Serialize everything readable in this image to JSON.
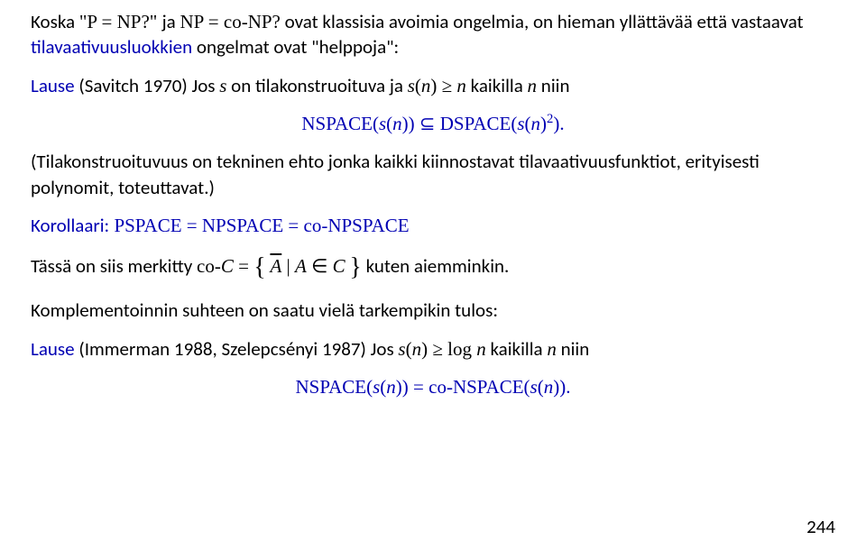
{
  "para1_a": "Koska ",
  "para1_b": "\"P = NP?\" ",
  "para1_c": "ja ",
  "para1_d": "NP = co-NP?",
  "para1_e": " ovat klassisia avoimia ongelmia, on hieman yllättävää että vastaavat ",
  "para1_f": "tilavaativuusluokkien",
  "para1_g": " ongelmat ovat \"helppoja\":",
  "lause1_a": "Lause",
  "lause1_b": " (Savitch 1970) Jos ",
  "lause1_c": "s",
  "lause1_d": " on tilakonstruoituva ja ",
  "lause1_e": "s",
  "lause1_f": "(",
  "lause1_g": "n",
  "lause1_h": ") ≥ ",
  "lause1_i": "n",
  "lause1_j": " kaikilla ",
  "lause1_k": "n",
  "lause1_l": " niin",
  "eq1_a": "NSPACE(",
  "eq1_b": "s",
  "eq1_c": "(",
  "eq1_d": "n",
  "eq1_e": ")) ⊆ DSPACE(",
  "eq1_f": "s",
  "eq1_g": "(",
  "eq1_h": "n",
  "eq1_i": ")",
  "eq1_sup": "2",
  "eq1_j": ").",
  "para2": "(Tilakonstruoituvuus on tekninen ehto jonka kaikki kiinnostavat tilavaativuusfunktiot, erityisesti polynomit, toteuttavat.)",
  "kor_a": "Korollaari:",
  "kor_b": " PSPACE = NPSPACE = co-NPSPACE",
  "para3_a": "Tässä on siis merkitty ",
  "para3_b": "co-",
  "para3_c": "C",
  "para3_d": " = ",
  "para3_e": "A",
  "para3_f": " | ",
  "para3_g": "A",
  "para3_h": " ∈ ",
  "para3_i": "C",
  "para3_j": " kuten aiemminkin.",
  "para4": "Komplementoinnin suhteen on saatu vielä tarkempikin tulos:",
  "lause2_a": "Lause",
  "lause2_b": " (Immerman 1988, Szelepcsényi 1987) Jos ",
  "lause2_c": "s",
  "lause2_d": "(",
  "lause2_e": "n",
  "lause2_f": ") ≥ log ",
  "lause2_g": "n",
  "lause2_h": " kaikilla ",
  "lause2_i": "n",
  "lause2_j": " niin",
  "eq2_a": "NSPACE(",
  "eq2_b": "s",
  "eq2_c": "(",
  "eq2_d": "n",
  "eq2_e": ")) = co-NSPACE(",
  "eq2_f": "s",
  "eq2_g": "(",
  "eq2_h": "n",
  "eq2_i": ")).",
  "pagenum": "244"
}
